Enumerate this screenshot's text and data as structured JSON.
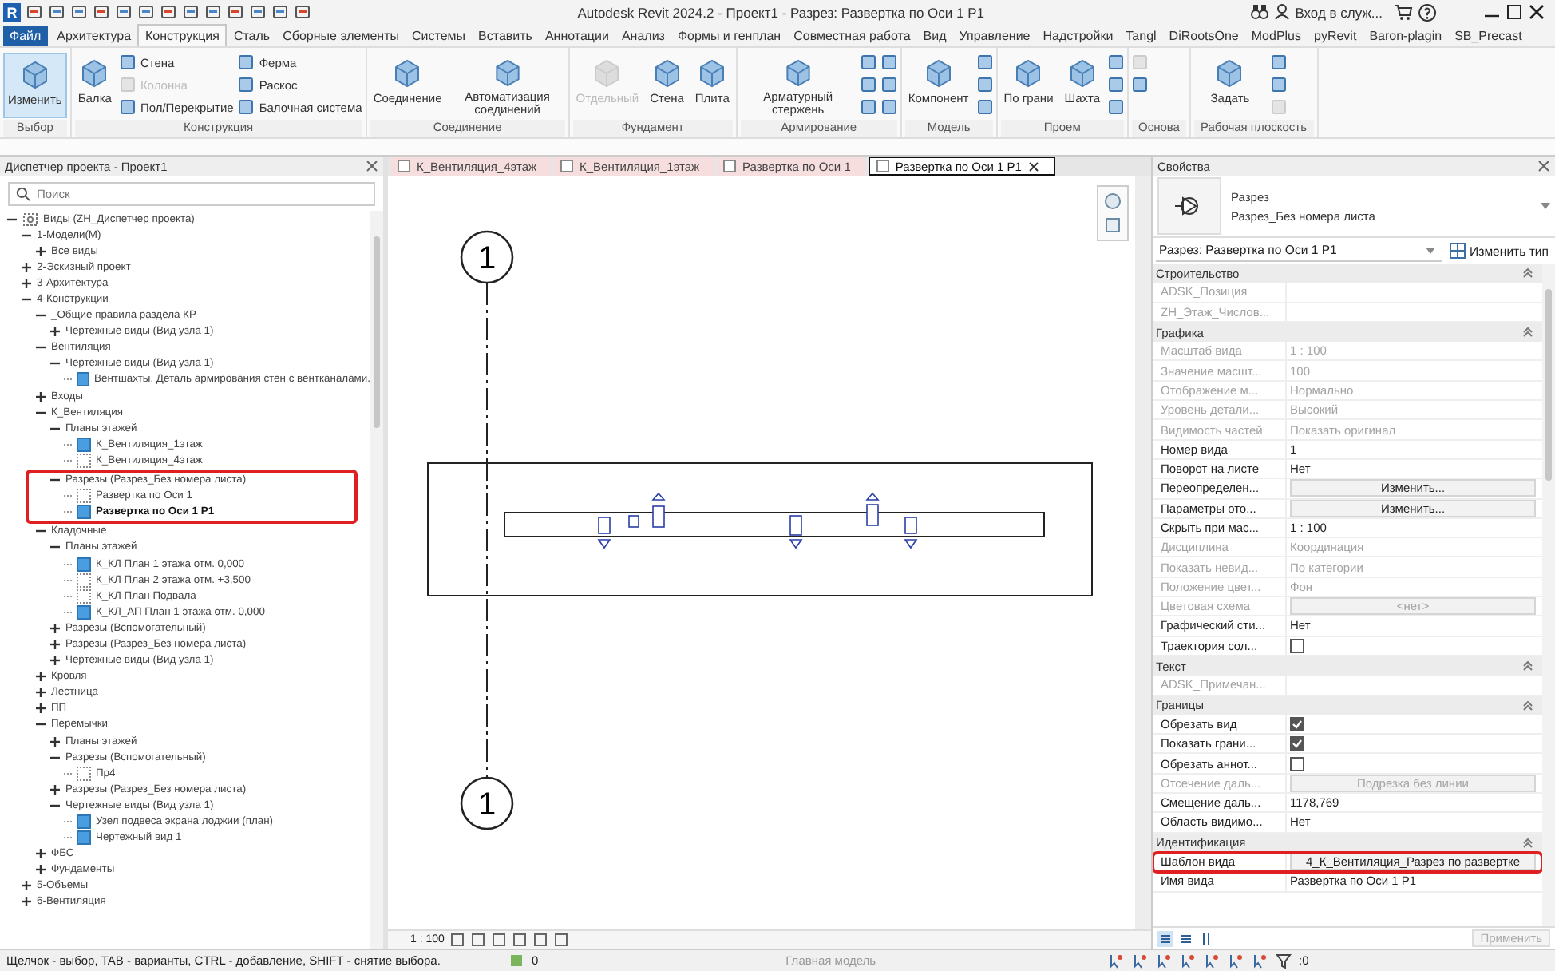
{
  "title_bar": {
    "logo": "R",
    "title": "Autodesk Revit 2024.2 - Проект1 - Разрез: Развертка по Оси 1 P1",
    "user": "Вход в служ..."
  },
  "ribbon": {
    "tabs": [
      {
        "label": "Файл",
        "kind": "file",
        "selected": false
      },
      {
        "label": "Архитектура",
        "kind": "tab",
        "selected": false
      },
      {
        "label": "Конструкция",
        "kind": "tab",
        "selected": true
      },
      {
        "label": "Сталь",
        "kind": "tab",
        "selected": false
      },
      {
        "label": "Сборные элементы",
        "kind": "tab",
        "selected": false
      },
      {
        "label": "Системы",
        "kind": "tab",
        "selected": false
      },
      {
        "label": "Вставить",
        "kind": "tab",
        "selected": false
      },
      {
        "label": "Аннотации",
        "kind": "tab",
        "selected": false
      },
      {
        "label": "Анализ",
        "kind": "tab",
        "selected": false
      },
      {
        "label": "Формы и генплан",
        "kind": "tab",
        "selected": false
      },
      {
        "label": "Совместная работа",
        "kind": "tab",
        "selected": false
      },
      {
        "label": "Вид",
        "kind": "tab",
        "selected": false
      },
      {
        "label": "Управление",
        "kind": "tab",
        "selected": false
      },
      {
        "label": "Надстройки",
        "kind": "tab",
        "selected": false
      },
      {
        "label": "Tangl",
        "kind": "tab",
        "selected": false
      },
      {
        "label": "DiRootsOne",
        "kind": "tab",
        "selected": false
      },
      {
        "label": "ModPlus",
        "kind": "tab",
        "selected": false
      },
      {
        "label": "pyRevit",
        "kind": "tab",
        "selected": false
      },
      {
        "label": "Baron-plagin",
        "kind": "tab",
        "selected": false
      },
      {
        "label": "SB_Precast",
        "kind": "tab",
        "selected": false
      }
    ],
    "panels": [
      {
        "name": "Выбор",
        "tools": [
          {
            "label": "Изменить",
            "kind": "large",
            "disabled": false,
            "selected": true
          }
        ]
      },
      {
        "name": "Конструкция",
        "tools": [
          {
            "label": "Балка",
            "kind": "large",
            "disabled": false,
            "selected": false
          },
          {
            "label": "Стена",
            "kind": "small",
            "disabled": false,
            "selected": false
          },
          {
            "label": "Колонна",
            "kind": "small",
            "disabled": true,
            "selected": false
          },
          {
            "label": "Пол/Перекрытие",
            "kind": "small",
            "disabled": false,
            "selected": false
          },
          {
            "label": "Ферма",
            "kind": "small",
            "disabled": false,
            "selected": false
          },
          {
            "label": "Раскос",
            "kind": "small",
            "disabled": false,
            "selected": false
          },
          {
            "label": "Балочная система",
            "kind": "small",
            "disabled": false,
            "selected": false
          }
        ]
      },
      {
        "name": "Соединение",
        "tools": [
          {
            "label": "Соединение",
            "kind": "large",
            "disabled": false,
            "selected": false
          },
          {
            "label": "Автоматизация соединений",
            "kind": "large",
            "disabled": false,
            "selected": false
          }
        ]
      },
      {
        "name": "Фундамент",
        "tools": [
          {
            "label": "Отдельный",
            "kind": "large",
            "disabled": true,
            "selected": false
          },
          {
            "label": "Стена",
            "kind": "large",
            "disabled": false,
            "selected": false
          },
          {
            "label": "Плита",
            "kind": "large",
            "disabled": false,
            "selected": false
          }
        ]
      },
      {
        "name": "Армирование",
        "tools": [
          {
            "label": "Арматурный стержень",
            "kind": "large",
            "disabled": false,
            "selected": false
          },
          {
            "kind": "small",
            "disabled": false,
            "selected": false
          },
          {
            "kind": "small",
            "disabled": false,
            "selected": false
          },
          {
            "kind": "small",
            "disabled": false,
            "selected": false
          },
          {
            "kind": "small",
            "disabled": false,
            "selected": false
          },
          {
            "kind": "small",
            "disabled": false,
            "selected": false
          },
          {
            "kind": "small",
            "disabled": false,
            "selected": false
          }
        ]
      },
      {
        "name": "Модель",
        "tools": [
          {
            "label": "Компонент",
            "kind": "large",
            "disabled": false,
            "selected": false
          },
          {
            "kind": "small",
            "disabled": false,
            "selected": false
          },
          {
            "kind": "small",
            "disabled": false,
            "selected": false
          },
          {
            "kind": "small",
            "disabled": false,
            "selected": false
          }
        ]
      },
      {
        "name": "Проем",
        "tools": [
          {
            "label": "По грани",
            "kind": "large",
            "disabled": false,
            "selected": false
          },
          {
            "label": "Шахта",
            "kind": "large",
            "disabled": false,
            "selected": false
          },
          {
            "kind": "small",
            "disabled": false,
            "selected": false
          },
          {
            "kind": "small",
            "disabled": false,
            "selected": false
          },
          {
            "kind": "small",
            "disabled": false,
            "selected": false
          }
        ]
      },
      {
        "name": "Основа",
        "tools": [
          {
            "kind": "small",
            "disabled": true,
            "selected": false
          },
          {
            "kind": "small",
            "disabled": false,
            "selected": false
          }
        ]
      },
      {
        "name": "Рабочая плоскость",
        "tools": [
          {
            "label": "Задать",
            "kind": "large",
            "disabled": false,
            "selected": false
          },
          {
            "kind": "small",
            "disabled": false,
            "selected": false
          },
          {
            "kind": "small",
            "disabled": false,
            "selected": false
          },
          {
            "kind": "small",
            "disabled": true,
            "selected": false
          }
        ]
      }
    ]
  },
  "browser": {
    "title": "Диспетчер проекта - Проект1",
    "search": {
      "placeholder": "Поиск"
    },
    "tree": [
      {
        "label": "Виды (ZH_Диспетчер проекта)",
        "kind": "root",
        "expanded": true,
        "children": [
          {
            "label": "1-Модели(М)",
            "kind": "group",
            "expanded": true,
            "children": [
              {
                "label": "Все виды",
                "kind": "group",
                "expanded": false
              }
            ]
          },
          {
            "label": "2-Эскизный проект",
            "kind": "group",
            "expanded": false
          },
          {
            "label": "3-Архитектура",
            "kind": "group",
            "expanded": false
          },
          {
            "label": "4-Конструкции",
            "kind": "group",
            "expanded": true,
            "children": [
              {
                "label": "_Общие правила раздела КР",
                "kind": "group",
                "expanded": true,
                "children": [
                  {
                    "label": "Чертежные виды (Вид узла 1)",
                    "kind": "group",
                    "expanded": false
                  }
                ]
              },
              {
                "label": "Вентиляция",
                "kind": "group",
                "expanded": true,
                "children": [
                  {
                    "label": "Чертежные виды (Вид узла 1)",
                    "kind": "group",
                    "expanded": true,
                    "children": [
                      {
                        "label": "Вентшахты. Деталь армирования стен с вентканалами.",
                        "kind": "view",
                        "on_sheet": true,
                        "selected": false
                      }
                    ]
                  }
                ]
              },
              {
                "label": "Входы",
                "kind": "group",
                "expanded": false
              },
              {
                "label": "К_Вентиляция",
                "kind": "group",
                "expanded": true,
                "children": [
                  {
                    "label": "Планы этажей",
                    "kind": "group",
                    "expanded": true,
                    "children": [
                      {
                        "label": "К_Вентиляция_1этаж",
                        "kind": "view",
                        "on_sheet": true,
                        "selected": false
                      },
                      {
                        "label": "К_Вентиляция_4этаж",
                        "kind": "view",
                        "on_sheet": false,
                        "selected": false
                      }
                    ]
                  },
                  {
                    "label": "Разрезы (Разрез_Без номера листа)",
                    "kind": "group",
                    "expanded": true,
                    "highlighted": true,
                    "children": [
                      {
                        "label": "Развертка по Оси 1",
                        "kind": "view",
                        "on_sheet": false,
                        "selected": false
                      },
                      {
                        "label": "Развертка по Оси 1 P1",
                        "kind": "view",
                        "on_sheet": true,
                        "selected": true
                      }
                    ]
                  }
                ]
              },
              {
                "label": "Кладочные",
                "kind": "group",
                "expanded": true,
                "children": [
                  {
                    "label": "Планы этажей",
                    "kind": "group",
                    "expanded": true,
                    "children": [
                      {
                        "label": "К_КЛ План 1 этажа отм. 0,000",
                        "kind": "view",
                        "on_sheet": true,
                        "selected": false
                      },
                      {
                        "label": "К_КЛ План 2 этажа отм. +3,500",
                        "kind": "view",
                        "on_sheet": false,
                        "selected": false
                      },
                      {
                        "label": "К_КЛ План Подвала",
                        "kind": "view",
                        "on_sheet": false,
                        "selected": false
                      },
                      {
                        "label": "К_КЛ_АП План 1 этажа отм. 0,000",
                        "kind": "view",
                        "on_sheet": true,
                        "selected": false
                      }
                    ]
                  },
                  {
                    "label": "Разрезы (Вспомогательный)",
                    "kind": "group",
                    "expanded": false
                  },
                  {
                    "label": "Разрезы (Разрез_Без номера листа)",
                    "kind": "group",
                    "expanded": false
                  },
                  {
                    "label": "Чертежные виды (Вид узла 1)",
                    "kind": "group",
                    "expanded": false
                  }
                ]
              },
              {
                "label": "Кровля",
                "kind": "group",
                "expanded": false
              },
              {
                "label": "Лестница",
                "kind": "group",
                "expanded": false
              },
              {
                "label": "ПП",
                "kind": "group",
                "expanded": false
              },
              {
                "label": "Перемычки",
                "kind": "group",
                "expanded": true,
                "children": [
                  {
                    "label": "Планы этажей",
                    "kind": "group",
                    "expanded": false
                  },
                  {
                    "label": "Разрезы (Вспомогательный)",
                    "kind": "group",
                    "expanded": true,
                    "children": [
                      {
                        "label": "Пр4",
                        "kind": "view",
                        "on_sheet": false,
                        "selected": false
                      }
                    ]
                  },
                  {
                    "label": "Разрезы (Разрез_Без номера листа)",
                    "kind": "group",
                    "expanded": false
                  },
                  {
                    "label": "Чертежные виды (Вид узла 1)",
                    "kind": "group",
                    "expanded": true,
                    "children": [
                      {
                        "label": "Узел подвеса экрана лоджии (план)",
                        "kind": "view",
                        "on_sheet": true,
                        "selected": false
                      },
                      {
                        "label": "Чертежный вид 1",
                        "kind": "view",
                        "on_sheet": true,
                        "selected": false
                      }
                    ]
                  }
                ]
              },
              {
                "label": "ФБС",
                "kind": "group",
                "expanded": false
              },
              {
                "label": "Фундаменты",
                "kind": "group",
                "expanded": false
              }
            ]
          },
          {
            "label": "5-Объемы",
            "kind": "group",
            "expanded": false
          },
          {
            "label": "6-Вентиляция",
            "kind": "group",
            "expanded": false
          }
        ]
      }
    ]
  },
  "canvas": {
    "view_tabs": [
      {
        "label": "К_Вентиляция_4этаж",
        "selected": false
      },
      {
        "label": "К_Вентиляция_1этаж",
        "selected": false
      },
      {
        "label": "Развертка по Оси 1",
        "selected": false
      },
      {
        "label": "Развертка по Оси 1 P1",
        "selected": true
      }
    ],
    "grid_bubbles": [
      "1",
      "1"
    ],
    "scale": "1 : 100"
  },
  "properties": {
    "title": "Свойства",
    "type_name": "Разрез",
    "type_subname": "Разрез_Без номера листа",
    "instance_selector": "Разрез: Развертка по Оси 1 P1",
    "edit_type": "Изменить тип",
    "groups": [
      {
        "name": "Строительство",
        "rows": [
          {
            "label": "ADSK_Позиция",
            "kind": "text",
            "disabled": true,
            "highlighted": false
          },
          {
            "label": "ZH_Этаж_Числов...",
            "kind": "text",
            "disabled": true,
            "highlighted": false
          }
        ]
      },
      {
        "name": "Графика",
        "rows": [
          {
            "label": "Масштаб вида",
            "value": "1 : 100",
            "kind": "text",
            "disabled": true,
            "highlighted": false
          },
          {
            "label": "Значение масшт...",
            "value": "100",
            "kind": "text",
            "disabled": true,
            "highlighted": false
          },
          {
            "label": "Отображение м...",
            "value": "Нормально",
            "kind": "text",
            "disabled": true,
            "highlighted": false
          },
          {
            "label": "Уровень детали...",
            "value": "Высокий",
            "kind": "text",
            "disabled": true,
            "highlighted": false
          },
          {
            "label": "Видимость частей",
            "value": "Показать оригинал",
            "kind": "text",
            "disabled": true,
            "highlighted": false
          },
          {
            "label": "Номер вида",
            "value": "1",
            "kind": "text",
            "disabled": false,
            "highlighted": false
          },
          {
            "label": "Поворот на листе",
            "value": "Нет",
            "kind": "text",
            "disabled": false,
            "highlighted": false
          },
          {
            "label": "Переопределен...",
            "value": "Изменить...",
            "kind": "button",
            "disabled": false,
            "highlighted": false
          },
          {
            "label": "Параметры ото...",
            "value": "Изменить...",
            "kind": "button",
            "disabled": false,
            "highlighted": false
          },
          {
            "label": "Скрыть при мас...",
            "value": "1 : 100",
            "kind": "text",
            "disabled": false,
            "highlighted": false
          },
          {
            "label": "Дисциплина",
            "value": "Координация",
            "kind": "text",
            "disabled": true,
            "highlighted": false
          },
          {
            "label": "Показать невид...",
            "value": "По категории",
            "kind": "text",
            "disabled": true,
            "highlighted": false
          },
          {
            "label": "Положение цвет...",
            "value": "Фон",
            "kind": "text",
            "disabled": true,
            "highlighted": false
          },
          {
            "label": "Цветовая схема",
            "value": "<нет>",
            "kind": "button",
            "disabled": true,
            "highlighted": false
          },
          {
            "label": "Графический сти...",
            "value": "Нет",
            "kind": "text",
            "disabled": false,
            "highlighted": false
          },
          {
            "label": "Траектория сол...",
            "kind": "checkbox",
            "checked": false,
            "disabled": false,
            "highlighted": false
          }
        ]
      },
      {
        "name": "Текст",
        "rows": [
          {
            "label": "ADSK_Примечан...",
            "kind": "text",
            "disabled": true,
            "highlighted": false
          }
        ]
      },
      {
        "name": "Границы",
        "rows": [
          {
            "label": "Обрезать вид",
            "kind": "checkbox",
            "checked": true,
            "disabled": false,
            "highlighted": false
          },
          {
            "label": "Показать грани...",
            "kind": "checkbox",
            "checked": true,
            "disabled": false,
            "highlighted": false
          },
          {
            "label": "Обрезать аннот...",
            "kind": "checkbox",
            "checked": false,
            "disabled": false,
            "highlighted": false
          },
          {
            "label": "Отсечение даль...",
            "value": "Подрезка без линии",
            "kind": "button",
            "disabled": true,
            "highlighted": false
          },
          {
            "label": "Смещение даль...",
            "value": "1178,769",
            "kind": "text",
            "disabled": false,
            "highlighted": false
          },
          {
            "label": "Область видимо...",
            "value": "Нет",
            "kind": "text",
            "disabled": false,
            "highlighted": false
          }
        ]
      },
      {
        "name": "Идентификация",
        "rows": [
          {
            "label": "Шаблон вида",
            "value": "4_К_Вентиляция_Разрез по развертке",
            "kind": "button",
            "disabled": false,
            "highlighted": true
          },
          {
            "label": "Имя вида",
            "value": "Развертка по Оси 1 P1",
            "kind": "text",
            "disabled": false,
            "highlighted": false
          }
        ]
      }
    ],
    "apply": "Применить"
  },
  "status_bar": {
    "hint": "Щелчок - выбор, TAB - варианты, CTRL - добавление, SHIFT - снятие выбора.",
    "count": "0",
    "model": "Главная модель",
    "filter_count": ":0"
  }
}
